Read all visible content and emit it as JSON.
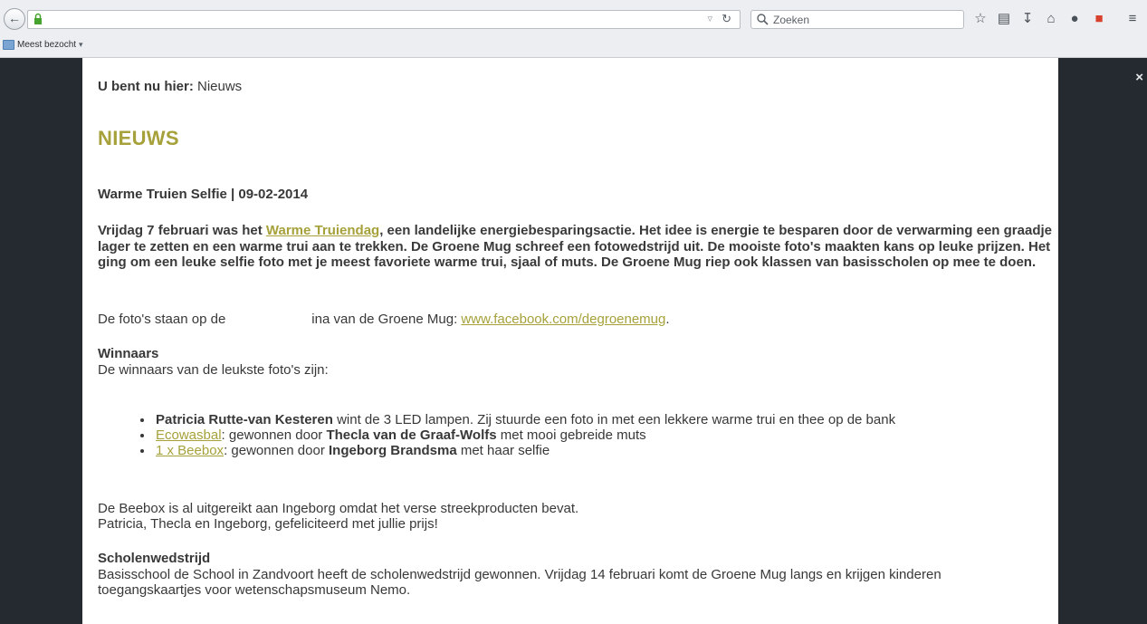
{
  "browser": {
    "url": "",
    "search_placeholder": "Zoeken",
    "bookmarks_bar": {
      "folder_label": "Meest bezocht"
    },
    "icons": [
      "back-icon",
      "lock-icon",
      "url-dropdown-icon",
      "reload-icon",
      "search-icon",
      "bookmark-star-icon",
      "reading-list-icon",
      "download-icon",
      "home-icon",
      "chat-icon",
      "pocket-icon",
      "menu-icon"
    ]
  },
  "overlay": {
    "close_label": "×"
  },
  "breadcrumb": {
    "prefix": "U bent nu hier:",
    "current": "Nieuws"
  },
  "page": {
    "heading": "NIEUWS"
  },
  "article": {
    "title": "Warme Truien Selfie | 09-02-2014",
    "intro_part1": "Vrijdag 7 februari was het ",
    "intro_link": "Warme Truiendag",
    "intro_part2": ", een landelijke energiebesparingsactie. Het idee is energie te besparen door de verwarming een graadje lager te zetten en een warme trui aan te trekken. De Groene Mug schreef een fotowedstrijd uit. De mooiste foto's maakten kans op leuke prijzen. Het ging om een leuke selfie foto met je meest favoriete warme trui, sjaal of muts. De Groene Mug riep ook klassen van basisscholen op mee te doen.",
    "facebook_part1": "De foto's staan op de",
    "facebook_part2": "ina van de Groene Mug: ",
    "facebook_link": "www.facebook.com/degroenemug",
    "facebook_end": ".",
    "winners_heading": "Winnaars",
    "winners_intro": "De winnaars van de leukste foto's zijn:",
    "winners": [
      {
        "prefix": "",
        "link": "",
        "name": "Patricia Rutte-van Kesteren",
        "text": " wint de 3 LED lampen. Zij stuurde een foto in met een lekkere warme trui en thee op de bank"
      },
      {
        "prefix": "",
        "link": "Ecowasbal",
        "text_before": ": gewonnen door ",
        "name": "Thecla van de Graaf-Wolfs",
        "text": " met mooi gebreide muts"
      },
      {
        "prefix": "",
        "link": "1 x Beebox",
        "text_before": ": gewonnen door ",
        "name": "Ingeborg Brandsma",
        "text": " met haar selfie"
      }
    ],
    "beebox_line": "De Beebox is al uitgereikt aan Ingeborg omdat het verse streekproducten bevat.",
    "congrats_line": "Patricia, Thecla en Ingeborg, gefeliciteerd met jullie prijs!",
    "school_heading": "Scholenwedstrijd",
    "school_text": "Basisschool de School in Zandvoort heeft de scholenwedstrijd gewonnen. Vrijdag 14 februari komt de Groene Mug langs en krijgen kinderen toegangskaartjes voor wetenschapsmuseum Nemo."
  },
  "colors": {
    "accent": "#a6a13a",
    "text": "#383838",
    "backdrop": "#242a30"
  }
}
